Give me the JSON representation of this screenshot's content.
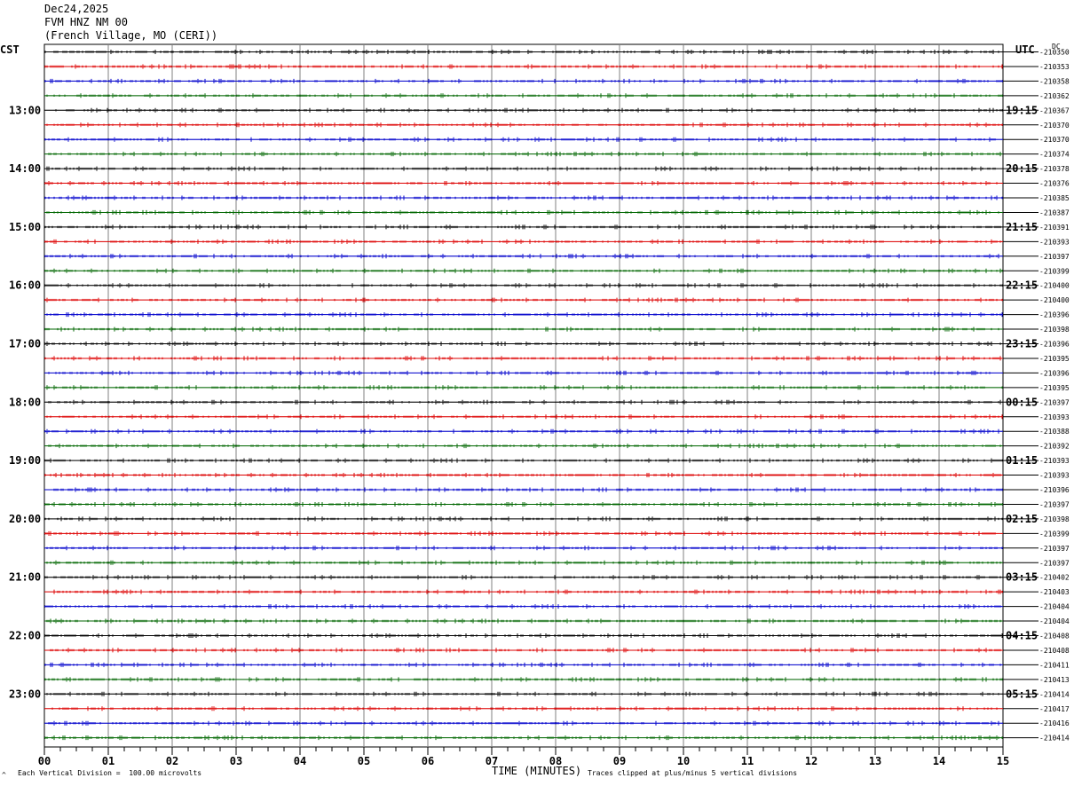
{
  "header": {
    "date": "Dec24,2025",
    "station": "FVM HNZ NM 00",
    "location": "(French Village, MO (CERI))"
  },
  "left_tz": "CST",
  "right_tz": "UTC",
  "dc_label": "DC",
  "footer": {
    "scale_note": "Each Vertical Division =  100.00 microvolts",
    "x_title": "TIME (MINUTES)",
    "clip_note": "Traces clipped at plus/minus 5 vertical divisions"
  },
  "colors": {
    "trace_cycle": [
      "#000000",
      "#dd0000",
      "#0000cc",
      "#006600"
    ],
    "grid": "#808080"
  },
  "chart_data": {
    "type": "line",
    "title": "FVM HNZ NM 00",
    "xlabel": "TIME (MINUTES)",
    "x_ticks": [
      "00",
      "01",
      "02",
      "03",
      "04",
      "05",
      "06",
      "07",
      "08",
      "09",
      "10",
      "11",
      "12",
      "13",
      "14",
      "15"
    ],
    "xlim": [
      0,
      15
    ],
    "rows": 48,
    "left_hour_labels": [
      "13:00",
      "14:00",
      "15:00",
      "16:00",
      "17:00",
      "18:00",
      "19:00",
      "20:00",
      "21:00",
      "22:00",
      "23:00"
    ],
    "right_hour_labels": [
      "19:15",
      "20:15",
      "21:15",
      "22:15",
      "23:15",
      "00:15",
      "01:15",
      "02:15",
      "03:15",
      "04:15",
      "05:15"
    ],
    "hour_label_rows": [
      4,
      8,
      12,
      16,
      20,
      24,
      28,
      32,
      36,
      40,
      44
    ],
    "dc_offsets": [
      "-210350",
      "-210353",
      "-210358",
      "-210362",
      "-210367",
      "-210370",
      "-210370",
      "-210374",
      "-210378",
      "-210376",
      "-210385",
      "-210387",
      "-210391",
      "-210393",
      "-210397",
      "-210399",
      "-210400",
      "-210400",
      "-210396",
      "-210398",
      "-210396",
      "-210395",
      "-210396",
      "-210395",
      "-210397",
      "-210393",
      "-210388",
      "-210392",
      "-210393",
      "-210393",
      "-210396",
      "-210397",
      "-210398",
      "-210399",
      "-210397",
      "-210397",
      "-210402",
      "-210403",
      "-210404",
      "-210404",
      "-210408",
      "-210408",
      "-210411",
      "-210413",
      "-210414",
      "-210417",
      "-210416",
      "-210414"
    ]
  }
}
